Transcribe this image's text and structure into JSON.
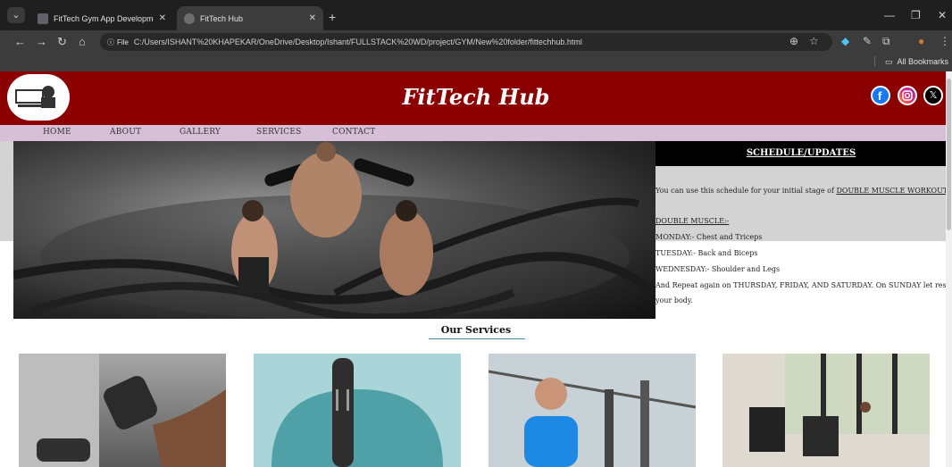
{
  "browser": {
    "tabs": [
      {
        "title": "FitTech Gym App Development.",
        "active": false
      },
      {
        "title": "FitTech Hub",
        "active": true
      }
    ],
    "url_chip": "File",
    "url": "C:/Users/ISHANT%20KHAPEKAR/OneDrive/Desktop/Ishant/FULLSTACK%20WD/project/GYM/New%20folder/fittechhub.html",
    "bookmarks_label": "All Bookmarks"
  },
  "site": {
    "title": "FitTech Hub",
    "nav": [
      "HOME",
      "ABOUT",
      "GALLERY",
      "SERVICES",
      "CONTACT"
    ],
    "social_icons": [
      "facebook-icon",
      "instagram-icon",
      "x-icon"
    ]
  },
  "schedule": {
    "heading": "SCHEDULE/UPDATES",
    "intro_text": "You can use this schedule for your initial stage of",
    "intro_link": "DOUBLE MUSCLE WORKOUT",
    "subheading": "DOUBLE MUSCLE:-",
    "days": [
      "MONDAY:- Chest and Triceps",
      "TUESDAY:- Back and Biceps",
      "WEDNESDAY:- Shoulder and Legs"
    ],
    "repeat_note": "And Repeat again on THURSDAY, FRIDAY, AND SATURDAY. On SUNDAY let rest your body."
  },
  "services": {
    "heading": "Our Services"
  },
  "colors": {
    "header_bg": "#8b0000",
    "nav_bg": "#d8bfd8",
    "schedule_head_bg": "#000000",
    "band_bg": "#d3d3d3"
  }
}
